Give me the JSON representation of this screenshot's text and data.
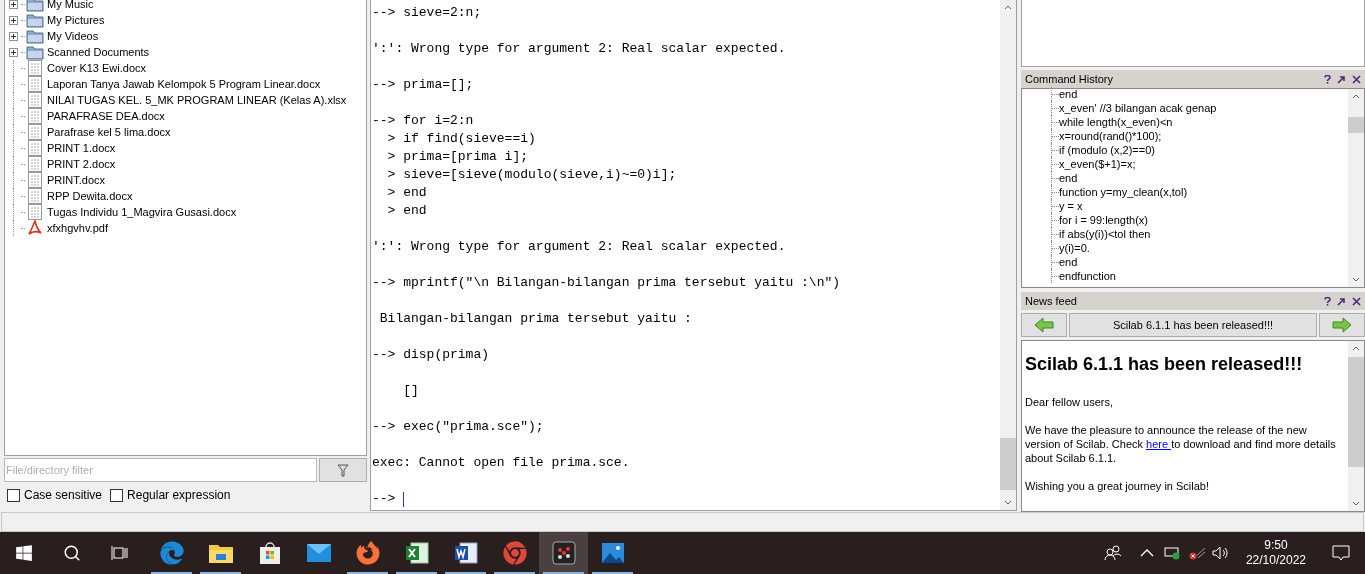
{
  "file_browser": {
    "items": [
      {
        "name": "My Music",
        "kind": "folder"
      },
      {
        "name": "My Pictures",
        "kind": "folder"
      },
      {
        "name": "My Videos",
        "kind": "folder"
      },
      {
        "name": "Scanned Documents",
        "kind": "folder"
      },
      {
        "name": "Cover K13 Ewi.docx",
        "kind": "file"
      },
      {
        "name": "Laporan Tanya Jawab Kelompok 5 Program Linear.docx",
        "kind": "file"
      },
      {
        "name": "NILAI TUGAS KEL. 5_MK PROGRAM LINEAR (Kelas A).xlsx",
        "kind": "file"
      },
      {
        "name": "PARAFRASE DEA.docx",
        "kind": "file"
      },
      {
        "name": "Parafrase kel 5 lima.docx",
        "kind": "file"
      },
      {
        "name": "PRINT 1.docx",
        "kind": "file"
      },
      {
        "name": "PRINT 2.docx",
        "kind": "file"
      },
      {
        "name": "PRINT.docx",
        "kind": "file"
      },
      {
        "name": "RPP Dewita.docx",
        "kind": "file"
      },
      {
        "name": "Tugas Individu 1_Magvira Gusasi.docx",
        "kind": "file"
      },
      {
        "name": "xfxhgvhv.pdf",
        "kind": "pdf"
      }
    ],
    "filter": {
      "placeholder": "File/directory filter"
    },
    "options": [
      {
        "label": "Case sensitive",
        "checked": false
      },
      {
        "label": "Regular expression",
        "checked": false
      }
    ]
  },
  "console": {
    "blocks": [
      [
        "--> sieve=2:n;"
      ],
      [
        "':': Wrong type for argument 2: Real scalar expected."
      ],
      [
        "--> prima=[];"
      ],
      [
        "--> for i=2:n",
        "  > if find(sieve==i)",
        "  > prima=[prima i];",
        "  > sieve=[sieve(modulo(sieve,i)~=0)i];",
        "  > end",
        "  > end"
      ],
      [
        "':': Wrong type for argument 2: Real scalar expected."
      ],
      [
        "--> mprintf(\"\\n Bilangan-bilangan prima tersebut yaitu :\\n\")"
      ],
      [
        " Bilangan-bilangan prima tersebut yaitu :"
      ],
      [
        "--> disp(prima)"
      ],
      [
        "    []"
      ],
      [
        "--> exec(\"prima.sce\");"
      ],
      [
        "exec: Cannot open file prima.sce."
      ],
      [
        "--> "
      ]
    ]
  },
  "command_history": {
    "title": "Command History",
    "items": [
      "end",
      "x_even' //3 bilangan acak genap",
      "while length(x_even)<n",
      "x=round(rand()*100);",
      "if (modulo (x,2)==0)",
      "x_even($+1)=x;",
      "end",
      "function y=my_clean(x,tol)",
      "y = x",
      "for i = 99:length(x)",
      "if abs(y(i))<tol then",
      "y(i)=0.",
      "end",
      "endfunction"
    ]
  },
  "news_feed": {
    "title": "News feed",
    "nav_title": "Scilab 6.1.1 has been released!!!",
    "headline": "Scilab 6.1.1 has been released!!!",
    "greeting": "Dear fellow users,",
    "body_before": "We have the pleasure to announce the release of the new version of Scilab. Check ",
    "link": "here ",
    "body_after": "to download and find more details about Scilab 6.1.1.",
    "closing": "Wishing you a great journey in Scilab!"
  },
  "taskbar": {
    "apps": [
      {
        "kind": "edge",
        "running": true,
        "selected": false
      },
      {
        "kind": "explorer",
        "running": true,
        "selected": false
      },
      {
        "kind": "store",
        "running": false,
        "selected": false
      },
      {
        "kind": "mail",
        "running": false,
        "selected": false
      },
      {
        "kind": "firefox",
        "running": true,
        "selected": false
      },
      {
        "kind": "excel",
        "running": true,
        "selected": false
      },
      {
        "kind": "word",
        "running": true,
        "selected": false
      },
      {
        "kind": "chrome",
        "running": true,
        "selected": false
      },
      {
        "kind": "scilab",
        "running": true,
        "selected": true
      },
      {
        "kind": "photos",
        "running": true,
        "selected": false
      }
    ],
    "time": "9:50",
    "date": "22/10/2022"
  }
}
